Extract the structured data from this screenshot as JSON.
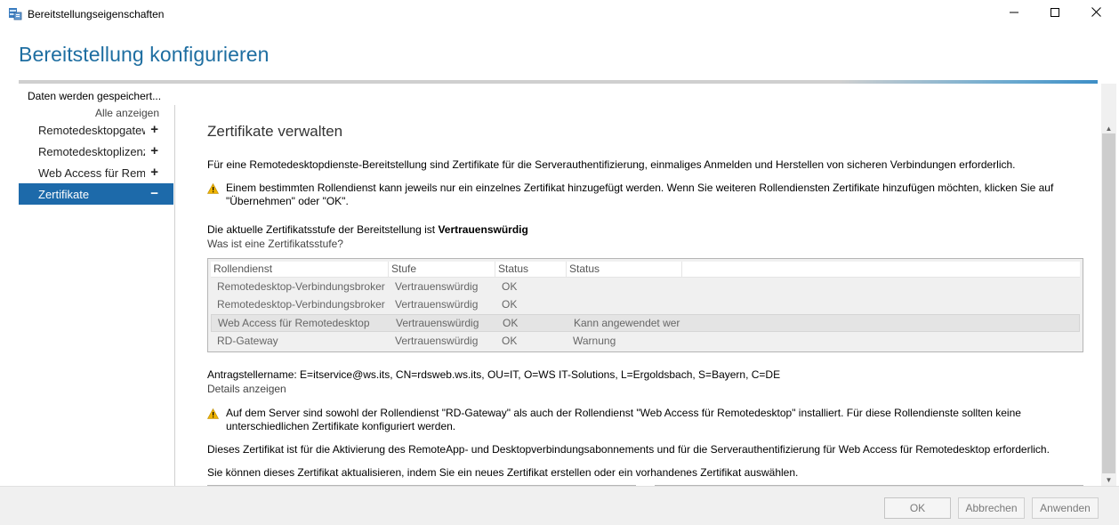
{
  "window": {
    "title": "Bereitstellungseigenschaften",
    "icons": {
      "app": "server-properties-icon",
      "minimize": "minimize-icon",
      "maximize": "maximize-icon",
      "close": "close-icon"
    }
  },
  "header": {
    "title": "Bereitstellung konfigurieren"
  },
  "sidebar": {
    "status": "Daten werden gespeichert...",
    "show_all": "Alle anzeigen",
    "items": [
      {
        "label": "Remotedesktopgateway",
        "toggle": "+"
      },
      {
        "label": "Remotedesktoplizenzierung",
        "toggle": "+"
      },
      {
        "label": "Web Access für Remotedesktop",
        "toggle": "+"
      },
      {
        "label": "Zertifikate",
        "toggle": "−",
        "active": true
      }
    ]
  },
  "main": {
    "title": "Zertifikate verwalten",
    "intro": "Für eine Remotedesktopdienste-Bereitstellung sind Zertifikate für die Serverauthentifizierung, einmaliges Anmelden und Herstellen von sicheren Verbindungen erforderlich.",
    "warning1": "Einem bestimmten Rollendienst kann jeweils nur ein einzelnes Zertifikat hinzugefügt werden. Wenn Sie weiteren Rollendiensten Zertifikate hinzufügen möchten, klicken Sie auf \"Übernehmen\" oder \"OK\".",
    "level_prefix": "Die aktuelle Zertifikatsstufe der Bereitstellung ist ",
    "level_value": "Vertrauenswürdig",
    "level_link": "Was ist eine Zertifikatsstufe?",
    "table": {
      "headers": [
        "Rollendienst",
        "Stufe",
        "Status",
        "Status"
      ],
      "rows": [
        {
          "role": "Remotedesktop-Verbindungsbroker",
          "level": "Vertrauenswürdig",
          "status": "OK",
          "status2": ""
        },
        {
          "role": "Remotedesktop-Verbindungsbroker",
          "level": "Vertrauenswürdig",
          "status": "OK",
          "status2": ""
        },
        {
          "role": "Web Access für Remotedesktop",
          "level": "Vertrauenswürdig",
          "status": "OK",
          "status2": "Kann angewendet wer"
        },
        {
          "role": "RD-Gateway",
          "level": "Vertrauenswürdig",
          "status": "OK",
          "status2": "Warnung"
        }
      ],
      "selected_row": 2
    },
    "applicant": "Antragstellername: E=itservice@ws.its, CN=rdsweb.ws.its, OU=IT, O=WS IT-Solutions, L=Ergoldsbach, S=Bayern, C=DE",
    "details_link": "Details anzeigen",
    "warning2": "Auf dem Server sind sowohl der Rollendienst \"RD-Gateway\" als auch der Rollendienst \"Web Access für Remotedesktop\" installiert. Für diese Rollendienste sollten keine unterschiedlichen Zertifikate konfiguriert werden.",
    "info1": "Dieses Zertifikat ist für die Aktivierung des RemoteApp- und Desktopverbindungsabonnements und für die Serverauthentifizierung für Web Access für Remotedesktop erforderlich.",
    "info2": "Sie können dieses Zertifikat aktualisieren, indem Sie ein neues Zertifikat erstellen oder ein vorhandenes Zertifikat auswählen."
  },
  "footer": {
    "ok": "OK",
    "cancel": "Abbrechen",
    "apply": "Anwenden"
  },
  "colors": {
    "accent": "#1d6aaa",
    "title": "#1e6ea1",
    "warning": "#f0b400"
  }
}
